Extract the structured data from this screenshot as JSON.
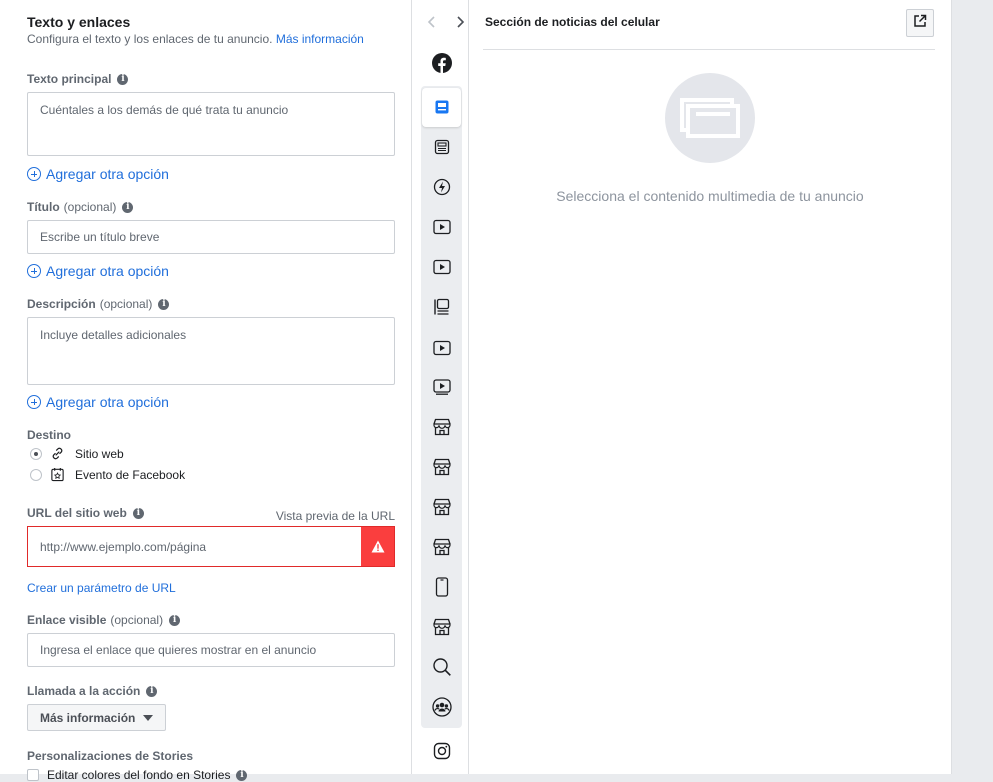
{
  "left": {
    "title": "Texto y enlaces",
    "subtitle": "Configura el texto y los enlaces de tu anuncio.",
    "more_info_link": "Más información",
    "primary_text": {
      "label": "Texto principal",
      "placeholder": "Cuéntales a los demás de qué trata tu anuncio"
    },
    "add_option_label": "Agregar otra opción",
    "headline": {
      "label": "Título",
      "optional": "(opcional)",
      "placeholder": "Escribe un título breve"
    },
    "description": {
      "label": "Descripción",
      "optional": "(opcional)",
      "placeholder": "Incluye detalles adicionales"
    },
    "destination": {
      "label": "Destino",
      "options": [
        {
          "label": "Sitio web",
          "selected": true,
          "icon": "link-icon"
        },
        {
          "label": "Evento de Facebook",
          "selected": false,
          "icon": "event-icon"
        }
      ]
    },
    "website_url": {
      "label": "URL del sitio web",
      "preview_link": "Vista previa de la URL",
      "placeholder": "http://www.ejemplo.com/página",
      "error": true
    },
    "create_url_param_link": "Crear un parámetro de URL",
    "display_link": {
      "label": "Enlace visible",
      "optional": "(opcional)",
      "placeholder": "Ingresa el enlace que quieres mostrar en el anuncio"
    },
    "cta": {
      "label": "Llamada a la acción",
      "selected": "Más información"
    },
    "stories": {
      "label": "Personalizaciones de Stories",
      "checkbox_label": "Editar colores del fondo en Stories"
    }
  },
  "placements": {
    "icons": [
      "facebook-icon",
      "mobile-feed-icon",
      "desktop-feed-icon",
      "instant-article-icon",
      "in-stream-video-icon",
      "video-feed-icon",
      "right-column-icon",
      "suggested-video-icon",
      "video-icon",
      "marketplace-icon",
      "marketplace-icon",
      "marketplace-icon",
      "marketplace-icon",
      "stories-icon",
      "marketplace-icon",
      "search-icon",
      "groups-icon",
      "instagram-icon"
    ],
    "selected_index": 1
  },
  "preview": {
    "title": "Sección de noticias del celular",
    "empty_message": "Selecciona el contenido multimedia de tu anuncio"
  },
  "colors": {
    "link": "#216fdb",
    "error": "#fa3e3e",
    "selected_placement": "#1877f2"
  }
}
